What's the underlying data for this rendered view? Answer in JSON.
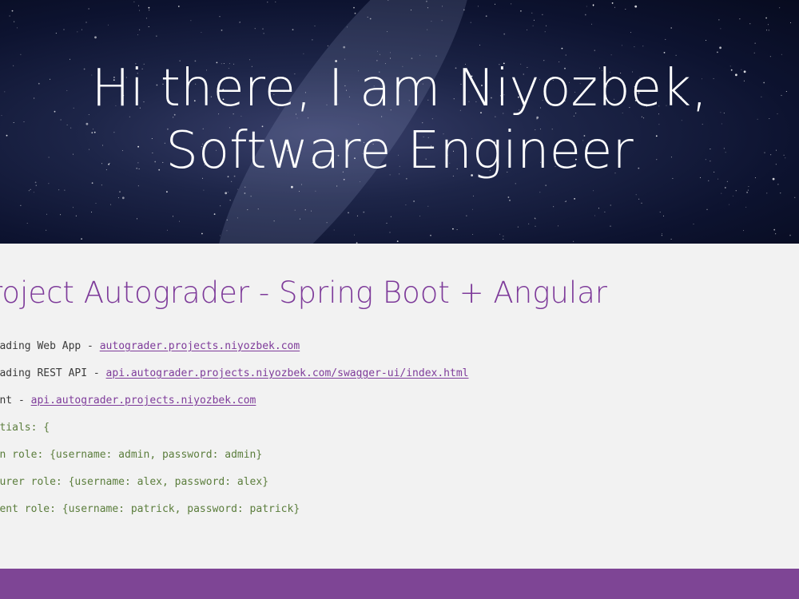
{
  "hero": {
    "line1": "Hi there, I am Niyozbek,",
    "line2": "Software Engineer"
  },
  "project": {
    "title": "roject Autograder - Spring Boot + Angular",
    "links": [
      {
        "label": "ograding Web App - ",
        "url_text": "autograder.projects.niyozbek.com"
      },
      {
        "label": "ograding REST API - ",
        "url_text": "api.autograder.projects.niyozbek.com/swagger-ui/index.html"
      },
      {
        "label": "point - ",
        "url_text": "api.autograder.projects.niyozbek.com"
      }
    ],
    "credentials": [
      "dentials: {",
      "dmin role: {username: admin, password: admin}",
      "ecturer role: {username: alex, password: alex}",
      "tudent role: {username: patrick, password: patrick}"
    ]
  },
  "colors": {
    "accent": "#7e3b9a",
    "footer": "#7e4595",
    "code_text": "#5b7d3c",
    "background": "#f2f2f2"
  }
}
